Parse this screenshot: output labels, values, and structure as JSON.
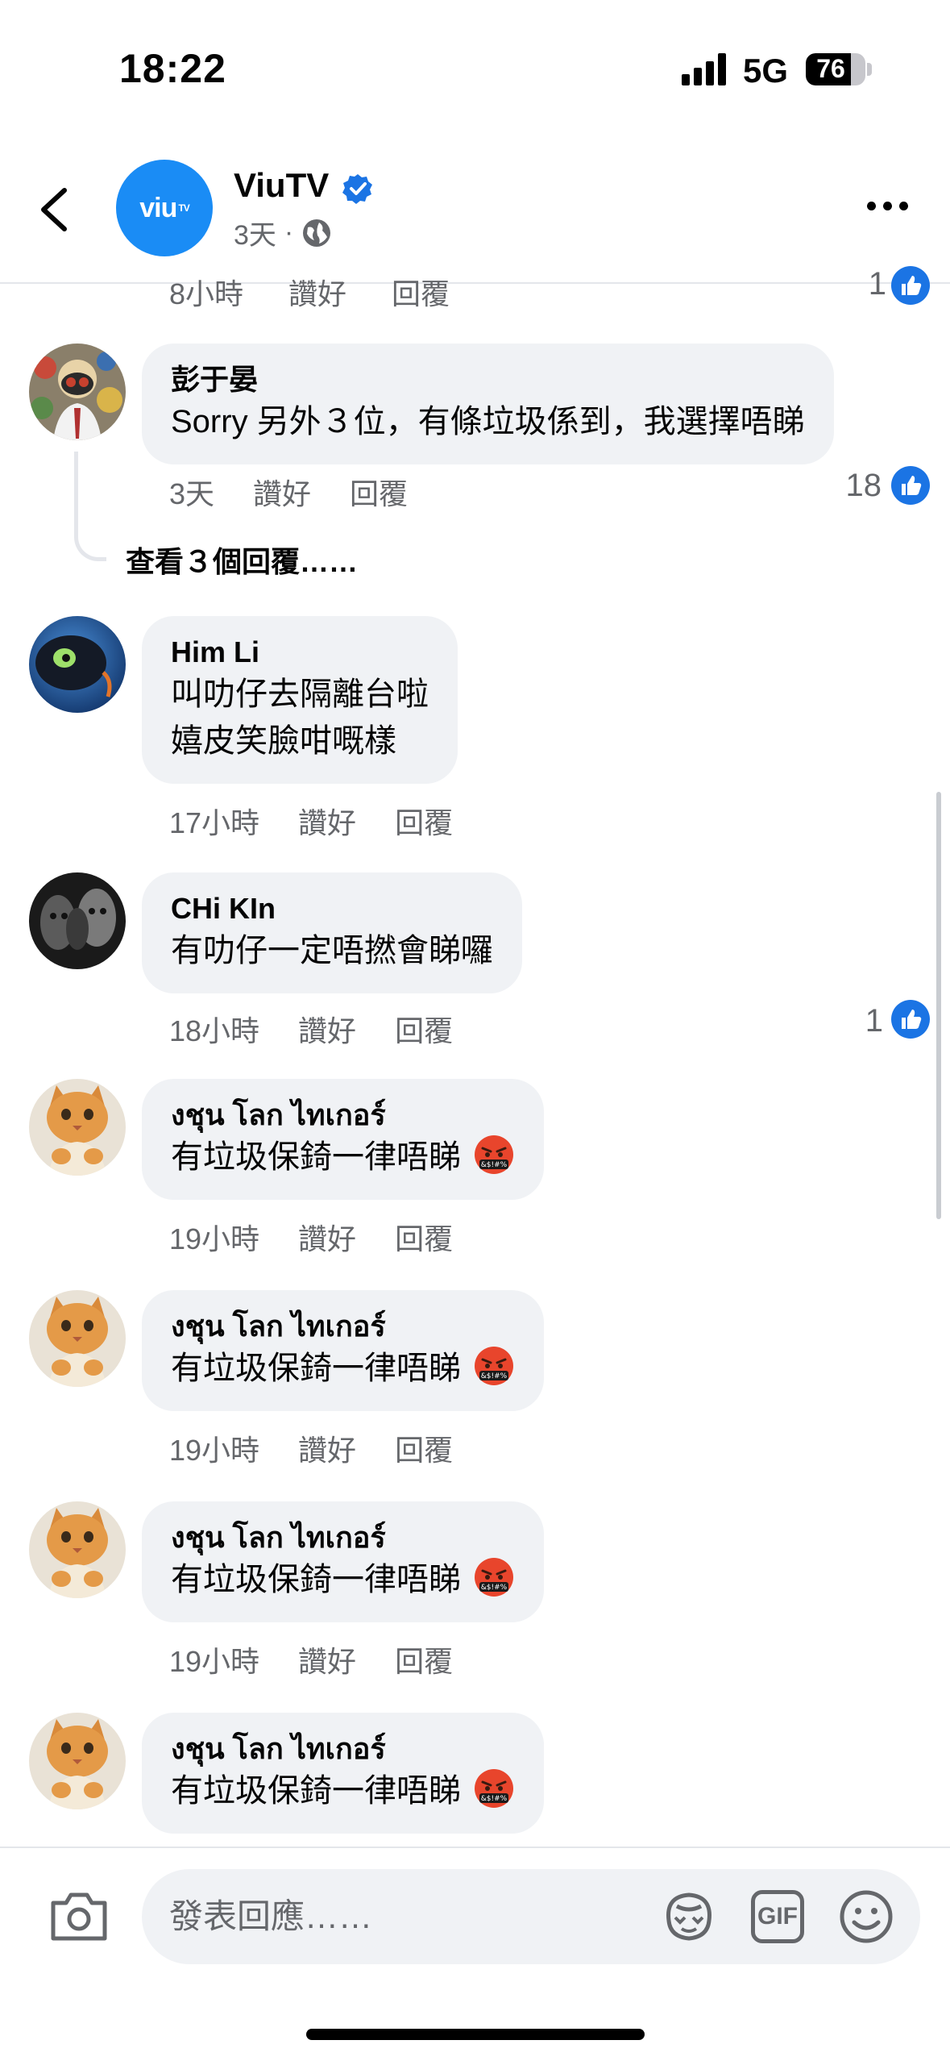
{
  "status_bar": {
    "time": "18:22",
    "network": "5G",
    "battery": 76
  },
  "header": {
    "page_name": "ViuTV",
    "avatar_text": "viu",
    "avatar_sup": "TV",
    "time_ago": "3天",
    "separator": "·",
    "icons": {
      "back": "chevron-left-icon",
      "verified": "verified-badge-icon",
      "audience": "globe-icon",
      "more": "more-dots-icon"
    },
    "colors": {
      "brand": "#1a8cf5",
      "verified": "#1b74e4"
    }
  },
  "partial_row": {
    "time": "8小時",
    "like": "讚好",
    "reply": "回覆",
    "likes": "1"
  },
  "comments": [
    {
      "author": "彭于晏",
      "text": [
        "Sorry 另外３位，有條垃圾係到，我選擇唔睇"
      ],
      "time": "3天",
      "like": "讚好",
      "reply": "回覆",
      "likes": "18",
      "avatar": "masked-figure"
    },
    {
      "author": "Him Li",
      "text": [
        "叫叻仔去隔離台啦",
        "嬉皮笑臉咁嘅樣"
      ],
      "time": "17小時",
      "like": "讚好",
      "reply": "回覆",
      "likes": "",
      "avatar": "cartoon-dragon"
    },
    {
      "author": "CHi KIn",
      "text": [
        "有叻仔一定唔撚會睇囉"
      ],
      "time": "18小時",
      "like": "讚好",
      "reply": "回覆",
      "likes": "1",
      "avatar": "dark-faces"
    },
    {
      "author": "งชุน โลก ไทเกอร์",
      "text": [
        "有垃圾保錡一律唔睇"
      ],
      "time": "19小時",
      "like": "讚好",
      "reply": "回覆",
      "likes": "",
      "avatar": "orange-cat",
      "emoji": "cursing-face-emoji"
    },
    {
      "author": "งชุน โลก ไทเกอร์",
      "text": [
        "有垃圾保錡一律唔睇"
      ],
      "time": "19小時",
      "like": "讚好",
      "reply": "回覆",
      "likes": "",
      "avatar": "orange-cat",
      "emoji": "cursing-face-emoji"
    },
    {
      "author": "งชุน โลก ไทเกอร์",
      "text": [
        "有垃圾保錡一律唔睇"
      ],
      "time": "19小時",
      "like": "讚好",
      "reply": "回覆",
      "likes": "",
      "avatar": "orange-cat",
      "emoji": "cursing-face-emoji"
    },
    {
      "author": "งชุน โลก ไทเกอร์",
      "text": [
        "有垃圾保錡一律唔睇"
      ],
      "time": "",
      "like": "",
      "reply": "",
      "likes": "",
      "avatar": "orange-cat",
      "emoji": "cursing-face-emoji"
    }
  ],
  "view_replies": "查看３個回覆……",
  "composer": {
    "placeholder": "發表回應……",
    "gif_label": "GIF",
    "icons": {
      "camera": "camera-icon",
      "avatar_sticker": "avatar-sticker-icon",
      "gif": "gif-icon",
      "emoji": "smiley-icon"
    }
  },
  "colors": {
    "bubble": "#f0f2f5",
    "secondary_text": "#65676b",
    "like_blue": "#1b74e4"
  }
}
